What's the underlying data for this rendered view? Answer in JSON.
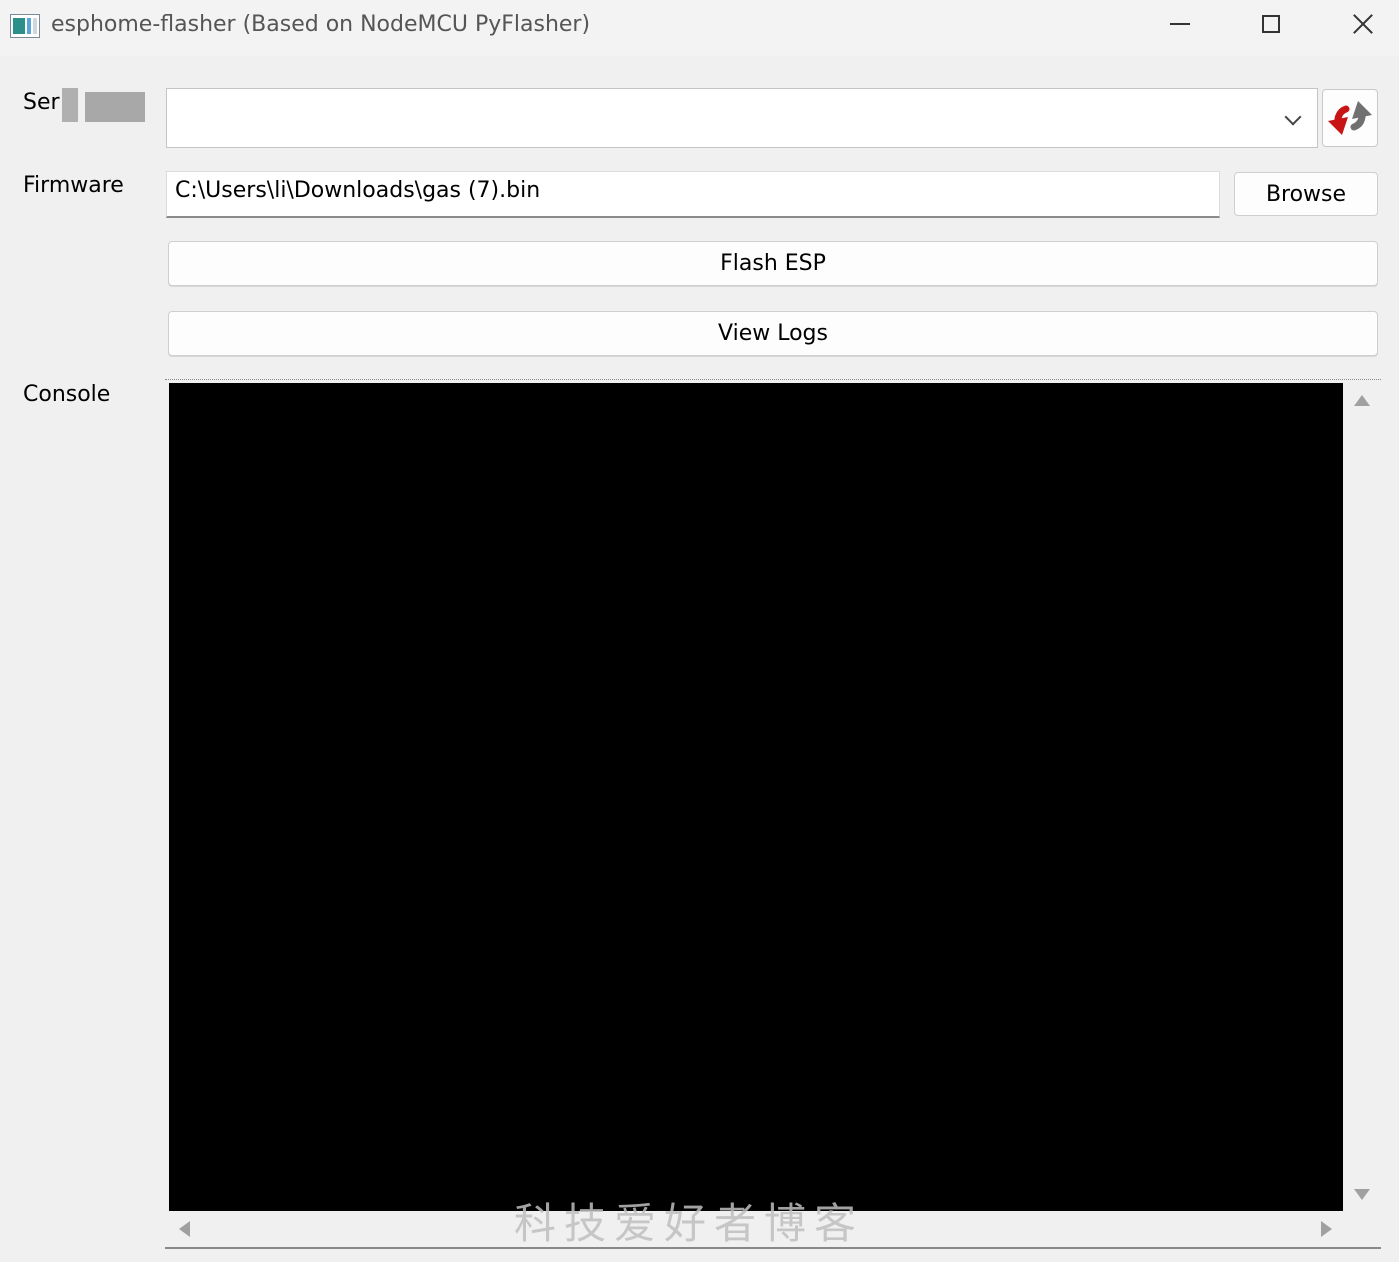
{
  "window": {
    "title": "esphome-flasher (Based on NodeMCU PyFlasher)",
    "icons": {
      "app": "app-icon",
      "minimize": "minimize-icon",
      "maximize": "maximize-icon",
      "close": "close-icon"
    }
  },
  "serial": {
    "label": "Ser",
    "selected_value": "",
    "dropdown_icon": "chevron-down-icon",
    "refresh_icon": "refresh-icon"
  },
  "firmware": {
    "label": "Firmware",
    "path_value": "C:\\Users\\li\\Downloads\\gas (7).bin",
    "browse_label": "Browse"
  },
  "actions": {
    "flash_label": "Flash ESP",
    "logs_label": "View Logs"
  },
  "console": {
    "label": "Console",
    "content": ""
  },
  "watermark": {
    "text": "科技爱好者博客"
  },
  "colors": {
    "console_background": "#000000",
    "window_background": "#f0f0f0",
    "refresh_red": "#c81414",
    "refresh_gray": "#707070"
  }
}
